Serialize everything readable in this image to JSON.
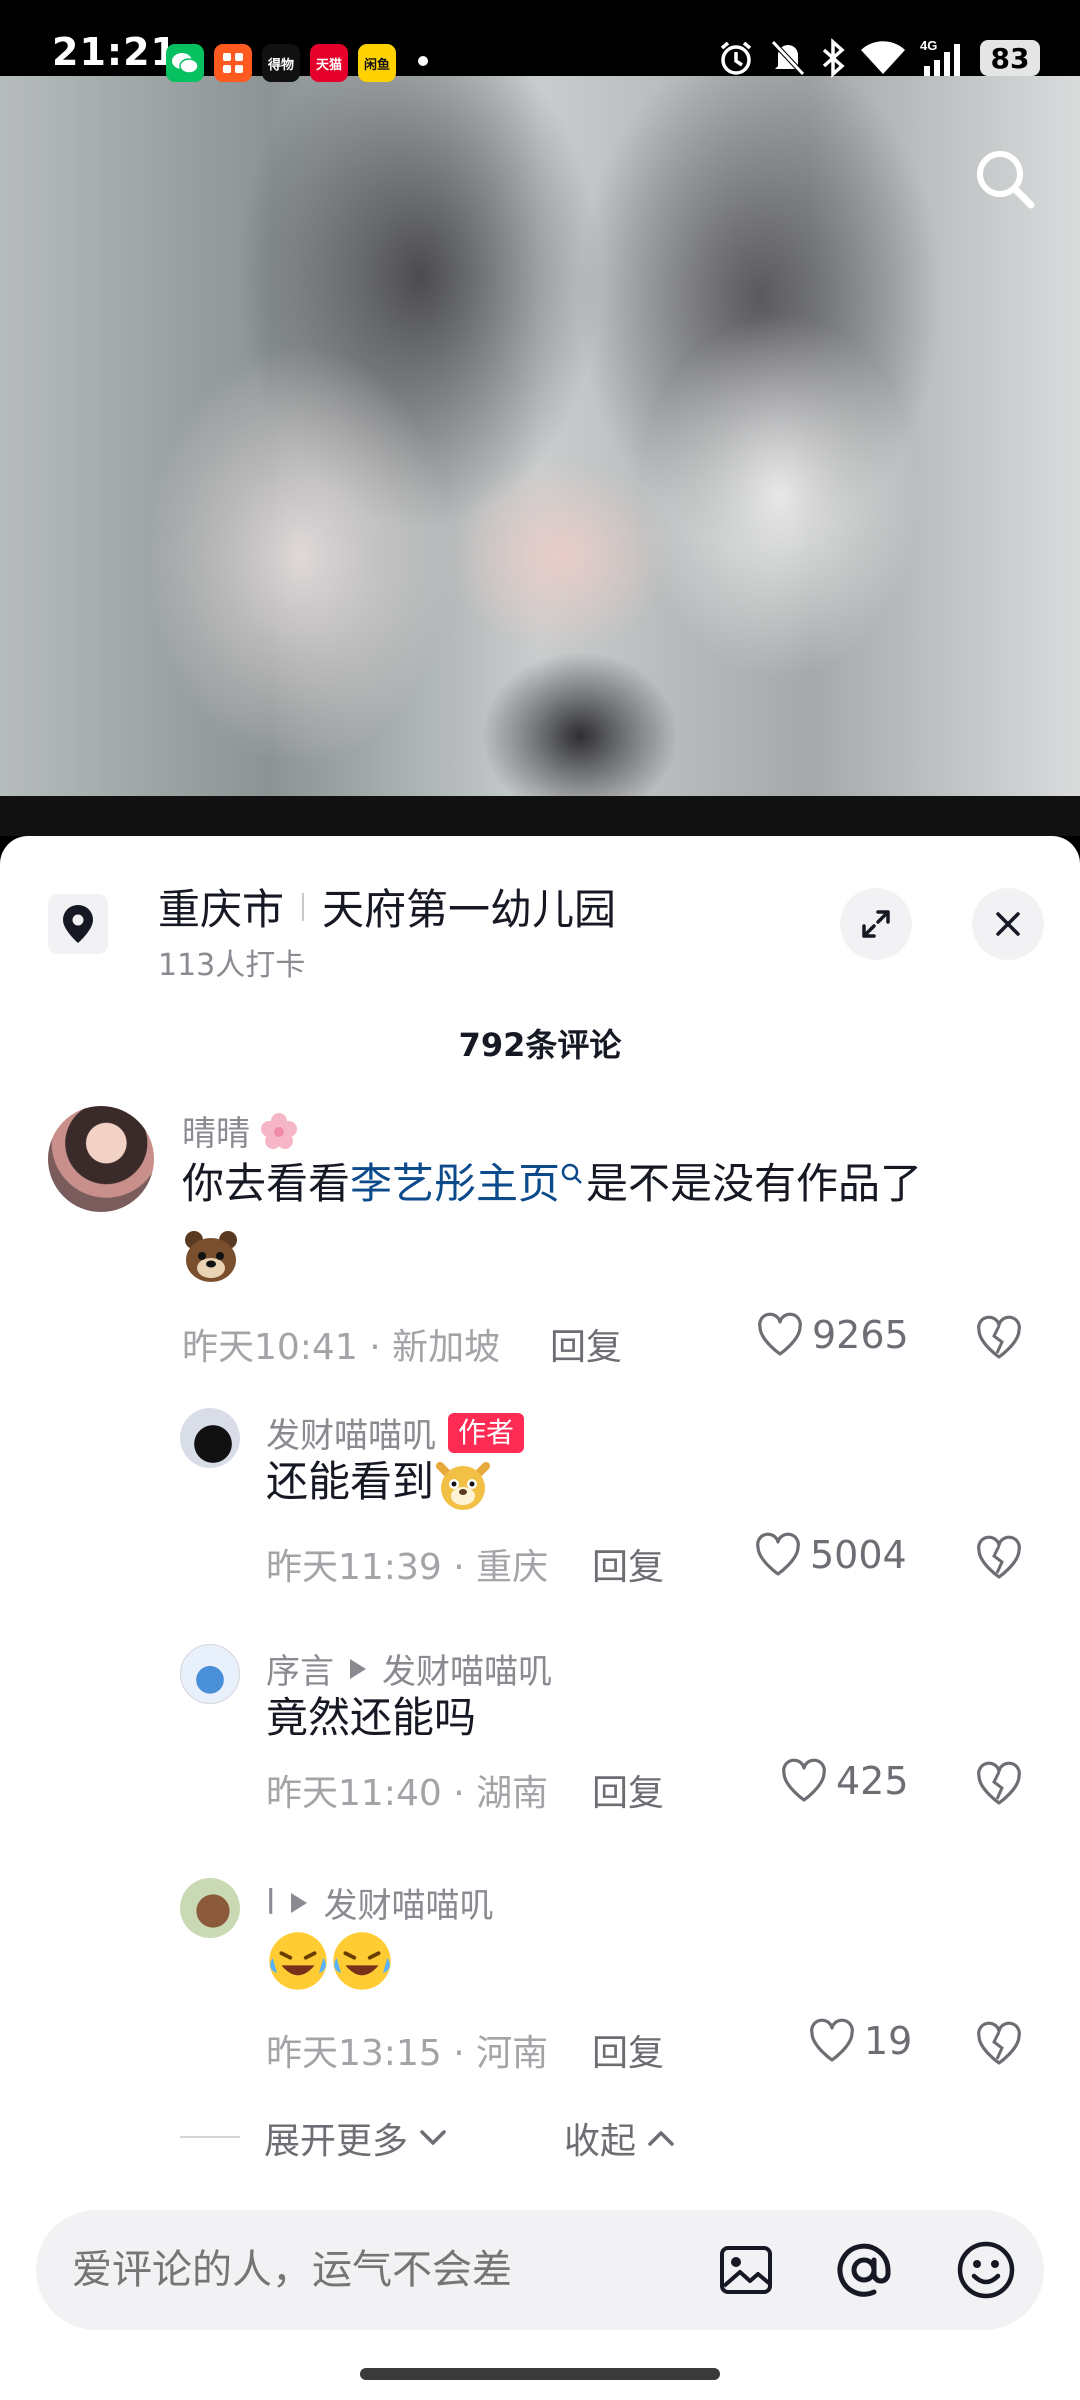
{
  "status_bar": {
    "time": "21:21",
    "app_icons": [
      "wechat-icon",
      "taobao-icon",
      "dewu-icon",
      "tmall-icon",
      "meituan-icon"
    ],
    "app_icon_labels": [
      "",
      "",
      "得物",
      "天猫",
      "闲鱼"
    ],
    "network": "4G",
    "battery": "83"
  },
  "video": {
    "search_icon": "search-icon"
  },
  "location": {
    "city": "重庆市",
    "place": "天府第一幼儿园",
    "checkins": "113人打卡"
  },
  "comment_count": "792条评论",
  "comments": [
    {
      "user": "晴晴",
      "text_before": "你去看看",
      "link": "李艺彤主页",
      "text_after": "是不是没有作品了",
      "time_loc": "昨天10:41 · 新加坡",
      "reply": "回复",
      "likes": "9265"
    },
    {
      "user": "发财喵喵叽",
      "author_tag": "作者",
      "text": "还能看到",
      "time_loc": "昨天11:39 · 重庆",
      "reply": "回复",
      "likes": "5004"
    },
    {
      "user": "序言",
      "reply_to": "发财喵喵叽",
      "text": "竟然还能吗",
      "time_loc": "昨天11:40 · 湖南",
      "reply": "回复",
      "likes": "425"
    },
    {
      "user": "l",
      "reply_to": "发财喵喵叽",
      "text": "",
      "time_loc": "昨天13:15 · 河南",
      "reply": "回复",
      "likes": "19"
    }
  ],
  "expand_more": "展开更多",
  "collapse": "收起",
  "input": {
    "placeholder": "爱评论的人，运气不会差"
  },
  "colors": {
    "accent": "#fe2c55",
    "link": "#0b4a8b",
    "muted": "#8a8b91"
  }
}
